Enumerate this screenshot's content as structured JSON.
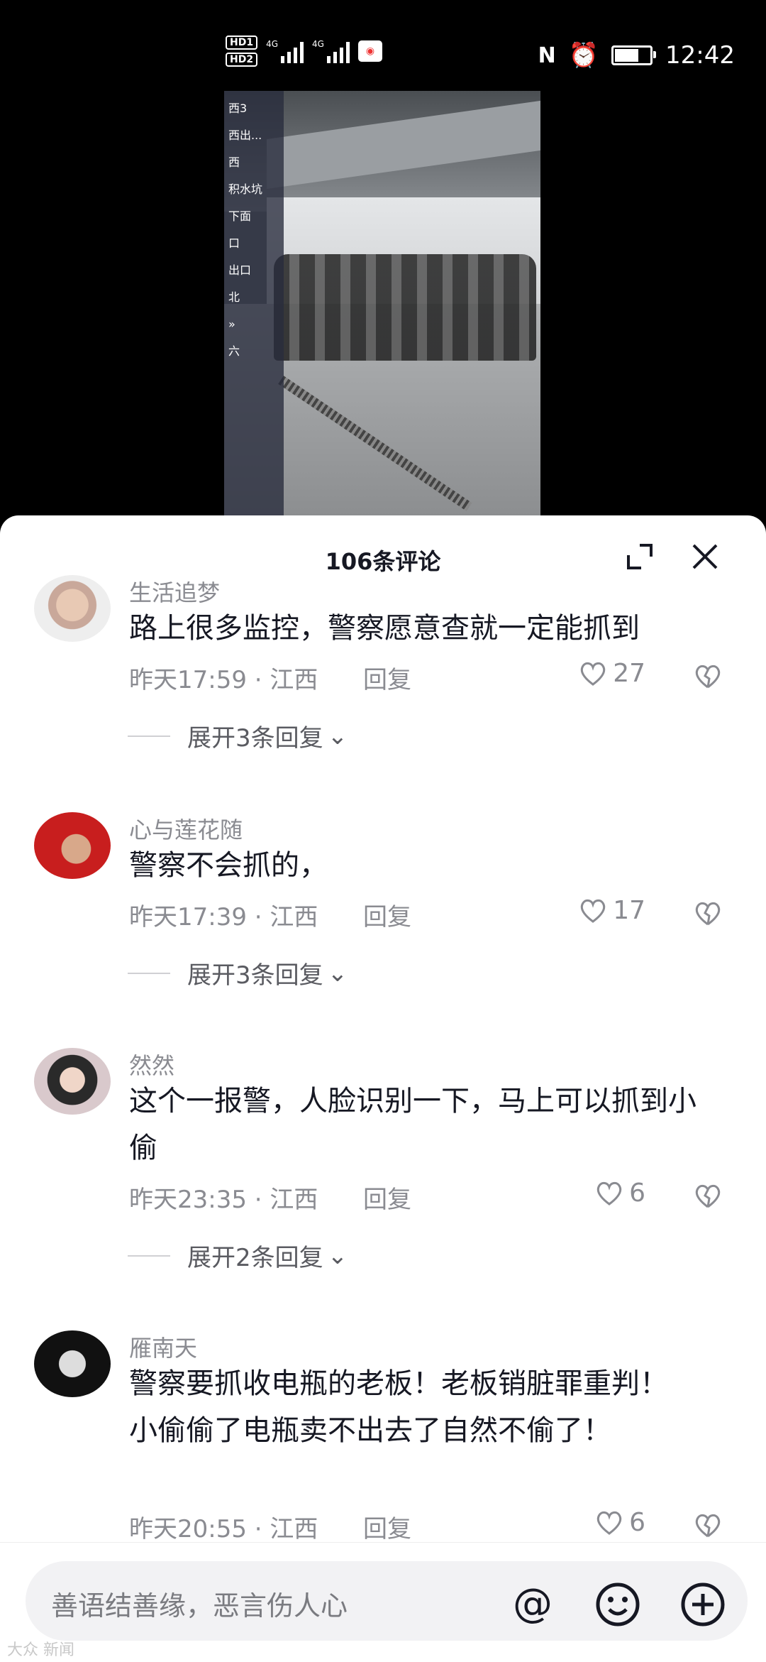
{
  "status_bar": {
    "time": "12:42",
    "hd1": "HD1",
    "hd2": "HD2",
    "net1": "4G",
    "net2": "4G",
    "battery_level": 0.75
  },
  "video": {
    "overlay_items": [
      "西3",
      "西出...",
      "西",
      "积水坑",
      "下面",
      "口",
      "出口",
      "北",
      "»",
      "六"
    ]
  },
  "comments_sheet": {
    "title": "106条评论",
    "comments": [
      {
        "username": "生活追梦",
        "text": "路上很多监控，警察愿意查就一定能抓到",
        "meta": "昨天17:59 · 江西",
        "reply_label": "回复",
        "likes": "27",
        "expand_label": "展开3条回复"
      },
      {
        "username": "心与莲花随",
        "text": "警察不会抓的，",
        "meta": "昨天17:39 · 江西",
        "reply_label": "回复",
        "likes": "17",
        "expand_label": "展开3条回复"
      },
      {
        "username": "然然",
        "text": "这个一报警，人脸识别一下，马上可以抓到小偷",
        "meta": "昨天23:35 · 江西",
        "reply_label": "回复",
        "likes": "6",
        "expand_label": "展开2条回复"
      },
      {
        "username": "雁南天",
        "text": "警察要抓收电瓶的老板！老板销脏罪重判！小偷偷了电瓶卖不出去了自然不偷了！",
        "meta": "昨天20:55 · 江西",
        "reply_label": "回复",
        "likes": "6"
      }
    ]
  },
  "input_bar": {
    "placeholder": "善语结善缘，恶言伤人心"
  },
  "watermark": "大众 新闻"
}
